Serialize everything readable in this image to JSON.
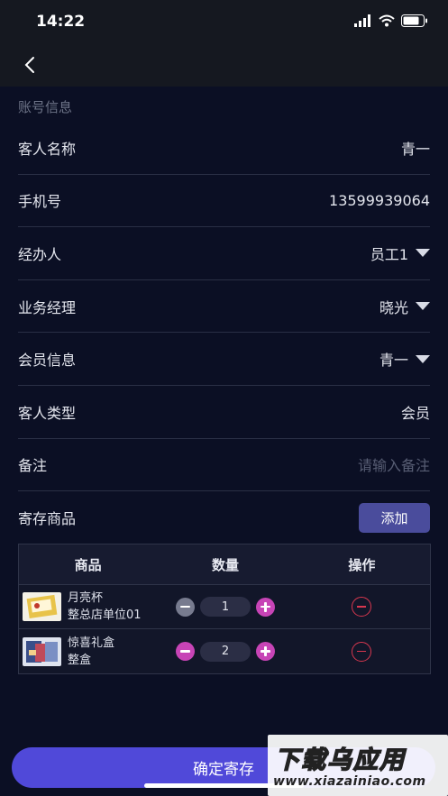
{
  "status_bar": {
    "time": "14:22"
  },
  "account_section": {
    "title": "账号信息"
  },
  "rows": [
    {
      "label": "客人名称",
      "value": "青一"
    },
    {
      "label": "手机号",
      "value": "13599939064"
    },
    {
      "label": "经办人",
      "value": "员工1"
    },
    {
      "label": "业务经理",
      "value": "晓光"
    },
    {
      "label": "会员信息",
      "value": "青一"
    },
    {
      "label": "客人类型",
      "value": "会员"
    },
    {
      "label": "备注",
      "placeholder": "请输入备注"
    }
  ],
  "deposit": {
    "label": "寄存商品",
    "add_label": "添加"
  },
  "table": {
    "headers": [
      "商品",
      "数量",
      "操作"
    ],
    "items": [
      {
        "name": "月亮杯",
        "unit": "整总店单位01",
        "qty": "1"
      },
      {
        "name": "惊喜礼盒",
        "unit": "整盒",
        "qty": "2"
      }
    ]
  },
  "confirm_label": "确定寄存",
  "watermark": {
    "title": "下载乌应用",
    "url": "www.xiazainiao.com"
  },
  "colors": {
    "background": "#0b0f24",
    "accent": "#5049d9",
    "pink": "#c744b6",
    "danger": "#d8374f"
  }
}
